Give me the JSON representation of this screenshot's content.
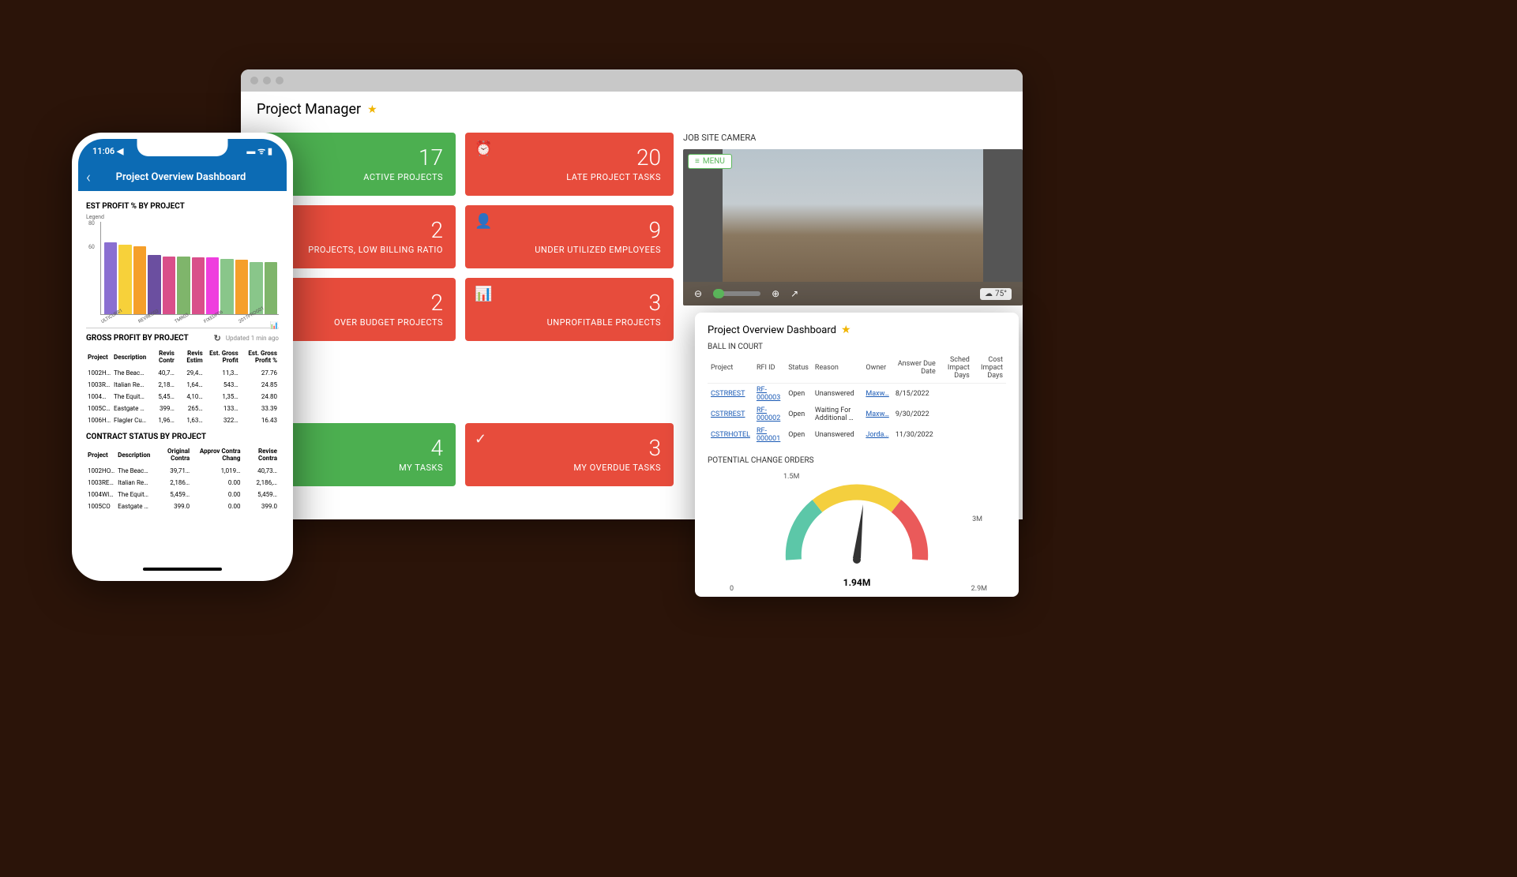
{
  "browser": {
    "title": "Project Manager",
    "tiles": [
      [
        {
          "n": "17",
          "label": "ACTIVE PROJECTS",
          "color": "green",
          "icon": ""
        },
        {
          "n": "20",
          "label": "LATE PROJECT TASKS",
          "color": "red",
          "icon": "⏰"
        }
      ],
      [
        {
          "n": "2",
          "label": "PROJECTS, LOW BILLING RATIO",
          "color": "red",
          "icon": ""
        },
        {
          "n": "9",
          "label": "UNDER UTILIZED EMPLOYEES",
          "color": "red",
          "icon": "👤"
        }
      ],
      [
        {
          "n": "2",
          "label": "OVER BUDGET PROJECTS",
          "color": "red",
          "icon": ""
        },
        {
          "n": "3",
          "label": "UNPROFITABLE PROJECTS",
          "color": "red",
          "icon": "📊"
        }
      ],
      [
        {
          "n": "",
          "label": "",
          "color": "blank",
          "icon": ""
        },
        {
          "n": "",
          "label": "",
          "color": "blank",
          "icon": ""
        }
      ],
      [
        {
          "n": "4",
          "label": "MY TASKS",
          "color": "green",
          "icon": ""
        },
        {
          "n": "3",
          "label": "MY OVERDUE TASKS",
          "color": "red",
          "icon": "✓"
        }
      ]
    ],
    "camera": {
      "title": "JOB SITE CAMERA",
      "menu": "MENU",
      "temp": "75°"
    }
  },
  "popup": {
    "title": "Project Overview Dashboard",
    "bic": {
      "title": "BALL IN COURT",
      "headers": [
        "Project",
        "RFI ID",
        "Status",
        "Reason",
        "Owner",
        "Answer Due Date",
        "Sched Impact Days",
        "Cost Impact Days"
      ],
      "rows": [
        {
          "project": "CSTRREST",
          "rfi": "RF-000003",
          "status": "Open",
          "reason": "Unanswered",
          "owner": "Maxw…",
          "due": "8/15/2022",
          "sched": "",
          "cost": ""
        },
        {
          "project": "CSTRREST",
          "rfi": "RF-000002",
          "status": "Open",
          "reason": "Waiting For Additional …",
          "owner": "Maxw…",
          "due": "9/30/2022",
          "sched": "",
          "cost": ""
        },
        {
          "project": "CSTRHOTEL",
          "rfi": "RF-000001",
          "status": "Open",
          "reason": "Unanswered",
          "owner": "Jorda…",
          "due": "11/30/2022",
          "sched": "",
          "cost": ""
        }
      ]
    },
    "gauge": {
      "title": "POTENTIAL CHANGE ORDERS",
      "value": "1.94M",
      "ticks": [
        "0",
        "1.5M",
        "3M",
        "2.9M"
      ]
    }
  },
  "phone": {
    "time": "11:06",
    "header": "Project Overview Dashboard",
    "chart_title": "EST PROFIT % BY PROJECT",
    "chart_legend": "Legend",
    "gross_title": "GROSS PROFIT BY PROJECT",
    "gross_updated": "Updated 1 min ago",
    "gross_headers": [
      "Project",
      "Description",
      "Revis Contr",
      "Revis Estim",
      "Est. Gross Profit",
      "Est. Gross Profit %"
    ],
    "gross_rows": [
      {
        "p": "1002H…",
        "d": "The Beach Hot…",
        "rc": "40,7…",
        "re": "29,4…",
        "gp": "11,3…",
        "gpp": "27.76"
      },
      {
        "p": "1003R…",
        "d": "Italian Restaura…",
        "rc": "2,18…",
        "re": "1,64…",
        "gp": "543…",
        "gpp": "24.85"
      },
      {
        "p": "1004…",
        "d": "The Equity Gro…",
        "rc": "5,45…",
        "re": "4,10…",
        "gp": "1,35…",
        "gpp": "24.80"
      },
      {
        "p": "1005C…",
        "d": "Eastgate Strip …",
        "rc": "399…",
        "re": "265…",
        "gp": "133…",
        "gpp": "33.39"
      },
      {
        "p": "1006H…",
        "d": "Flagler Custom …",
        "rc": "1,96…",
        "re": "1,63…",
        "gp": "322…",
        "gpp": "16.43"
      }
    ],
    "contract_title": "CONTRACT STATUS BY PROJECT",
    "contract_headers": [
      "Project",
      "Description",
      "Original Contra",
      "Approv Contra Chang",
      "Revise Contra"
    ],
    "contract_rows": [
      {
        "p": "1002HO…",
        "d": "The Beach Hotel a…",
        "oc": "39,71…",
        "ac": "1,019…",
        "rc": "40,73…"
      },
      {
        "p": "1003RE…",
        "d": "Italian Restaurant …",
        "oc": "2,186…",
        "ac": "0.00",
        "rc": "2,186,…"
      },
      {
        "p": "1004WI…",
        "d": "The Equity Group -…",
        "oc": "5,459…",
        "ac": "0.00",
        "rc": "5,459…"
      },
      {
        "p": "1005CO",
        "d": "Eastgate Strip Mall",
        "oc": "399.0",
        "ac": "0.00",
        "rc": "399.0"
      }
    ]
  },
  "chart_data": {
    "type": "bar",
    "title": "EST PROFIT % BY PROJECT",
    "ylabel": "",
    "ylim": [
      0,
      80
    ],
    "yticks": [
      0,
      60,
      80
    ],
    "categories": [
      "ULTICURR1",
      "",
      "REVREC02",
      "",
      "TMR03",
      "",
      "FIXEDP06",
      "",
      "2017PROG01",
      ""
    ],
    "values": [
      62,
      60,
      59,
      51,
      50,
      50,
      49,
      49,
      48,
      47,
      45,
      45
    ],
    "colors": [
      "#8a6fd1",
      "#f7d13a",
      "#f59f2a",
      "#6b4fa0",
      "#d94f8a",
      "#7fb56b",
      "#d94f8a",
      "#ef3ede",
      "#89c68a",
      "#f59f2a",
      "#89c68a",
      "#7fb56b"
    ]
  }
}
